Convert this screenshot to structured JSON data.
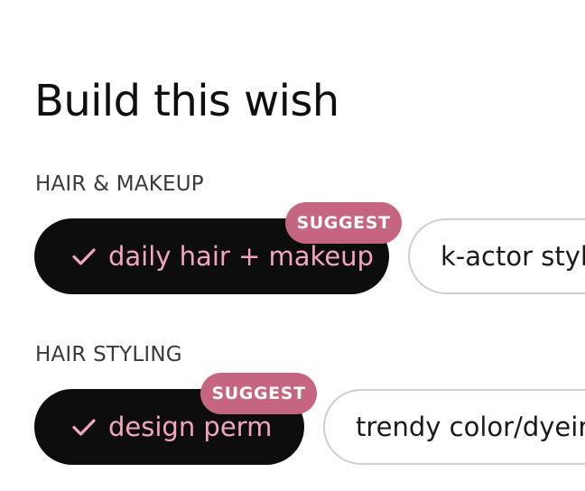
{
  "title": "Build this wish",
  "sections": [
    {
      "label": "HAIR & MAKEUP",
      "chips": [
        {
          "label": "daily hair + makeup",
          "selected": true,
          "badge": "SUGGEST"
        },
        {
          "label": "k-actor styl",
          "selected": false
        }
      ]
    },
    {
      "label": "HAIR STYLING",
      "chips": [
        {
          "label": "design perm",
          "selected": true,
          "badge": "SUGGEST"
        },
        {
          "label": "trendy color/dyeir",
          "selected": false
        }
      ]
    }
  ],
  "icons": {
    "selected_chip": "check-icon"
  },
  "colors": {
    "selected_chip_bg": "#0d0d0d",
    "selected_chip_text": "#f2a6bd",
    "badge_bg": "#c6657f",
    "unselected_border": "#cfcfcf"
  }
}
